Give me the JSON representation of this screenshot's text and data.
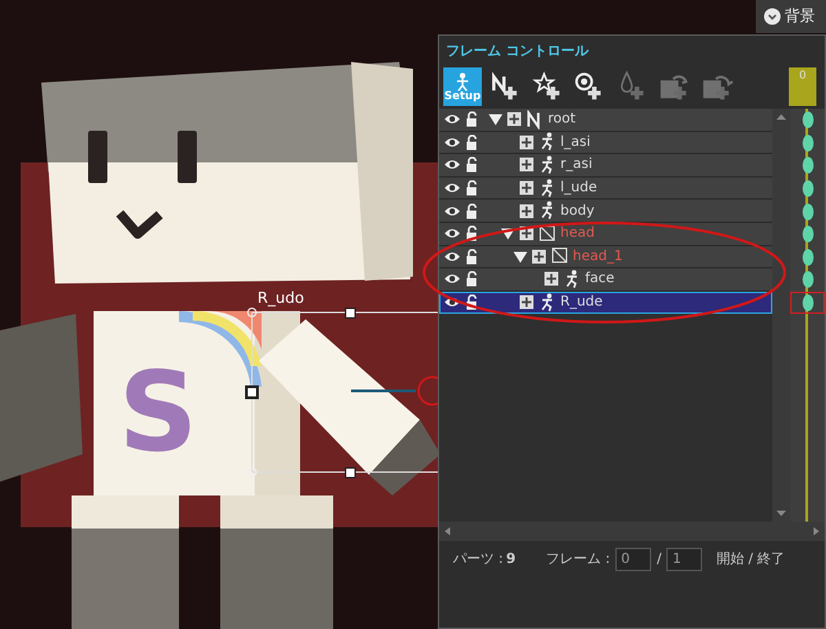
{
  "canvas": {
    "bone_label": "R_udo",
    "chest_letter": "S"
  },
  "background_button": {
    "label": "背景"
  },
  "panel": {
    "title": "フレーム コントロール",
    "toolbar": [
      {
        "kind": "setup",
        "label": "Setup",
        "selected": true,
        "disabled": false
      },
      {
        "kind": "add-null",
        "disabled": false
      },
      {
        "kind": "add-star",
        "disabled": false
      },
      {
        "kind": "add-target",
        "disabled": false
      },
      {
        "kind": "add-drop",
        "disabled": true
      },
      {
        "kind": "undo",
        "disabled": true
      },
      {
        "kind": "redo",
        "disabled": true
      }
    ],
    "timeline_marker": "0",
    "tree": [
      {
        "label": "root",
        "kind": "null",
        "expanded": true,
        "selected": false,
        "children": [
          {
            "label": "l_asi",
            "kind": "bone",
            "selected": false
          },
          {
            "label": "r_asi",
            "kind": "bone",
            "selected": false
          },
          {
            "label": "l_ude",
            "kind": "bone",
            "selected": false
          },
          {
            "label": "body",
            "kind": "bone",
            "selected": false
          },
          {
            "label": "head",
            "kind": "mesh",
            "expanded": true,
            "selected": false,
            "children": [
              {
                "label": "head_1",
                "kind": "mesh",
                "expanded": true,
                "selected": false,
                "children": [
                  {
                    "label": "face",
                    "kind": "bone",
                    "selected": false
                  }
                ]
              }
            ]
          },
          {
            "label": "R_ude",
            "kind": "bone",
            "selected": true
          }
        ]
      }
    ],
    "status": {
      "parts_label": "パーツ :",
      "parts_count": "9",
      "frame_label": "フレーム :",
      "frame_value": "0",
      "separator": "/",
      "frame_total": "1",
      "range_label": "開始 / 終了"
    }
  }
}
